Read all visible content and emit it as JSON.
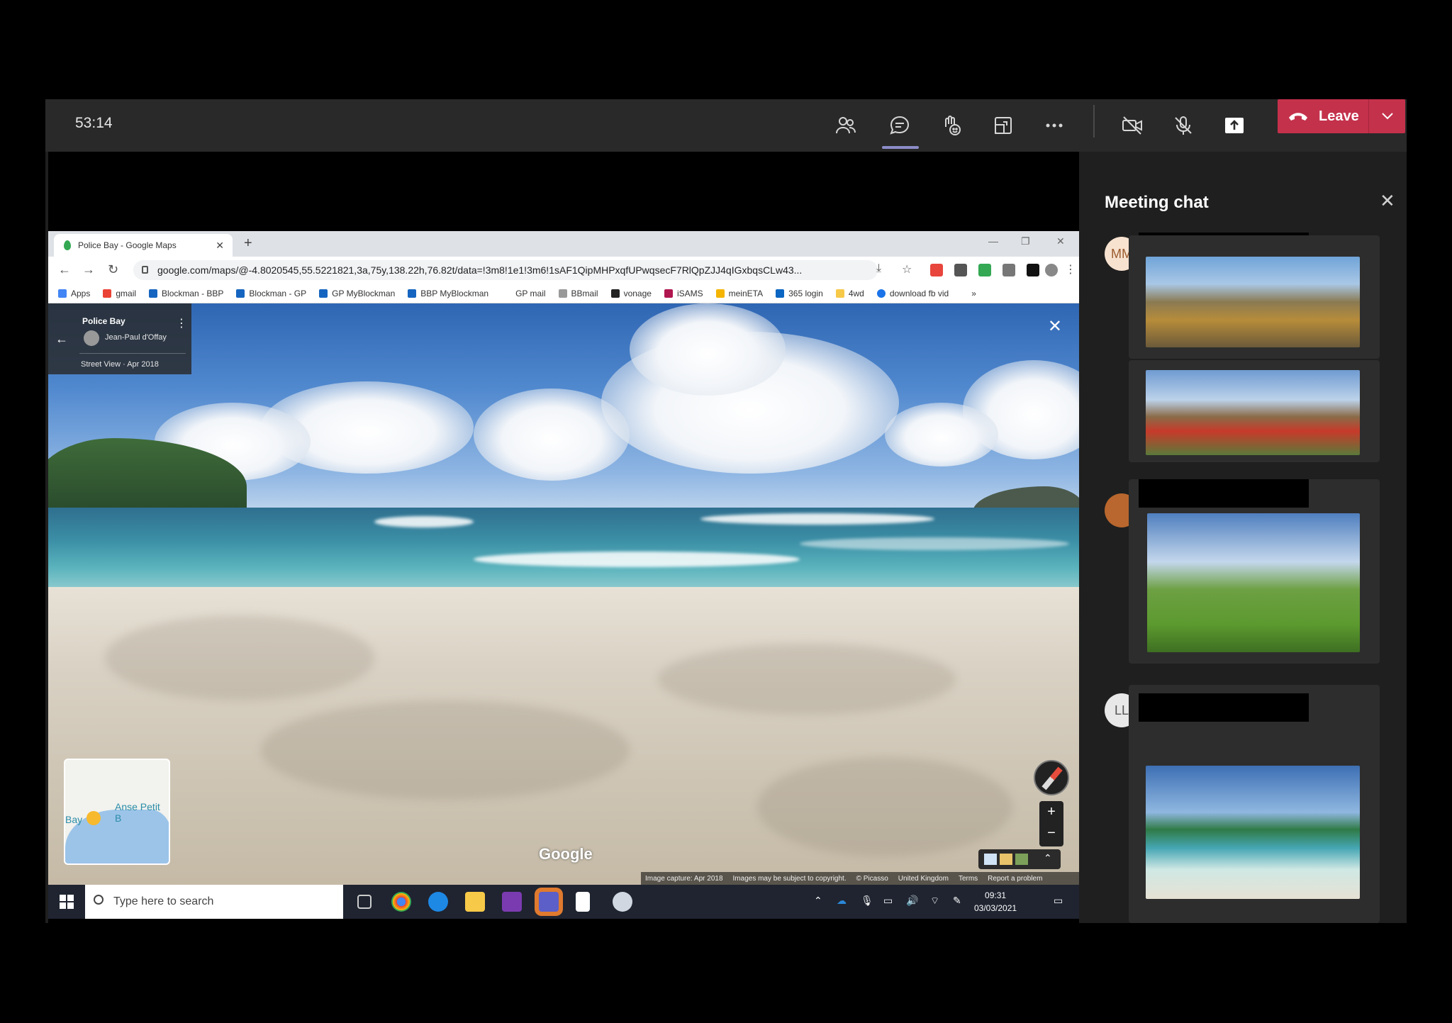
{
  "meeting": {
    "timer": "53:14",
    "leave_label": "Leave"
  },
  "browser": {
    "tab_title": "Police Bay - Google Maps",
    "url": "google.com/maps/@-4.8020545,55.5221821,3a,75y,138.22h,76.82t/data=!3m8!1e1!3m6!1sAF1QipMHPxqfUPwqsecF7RlQpZJJ4qIGxbqsCLw43...",
    "bookmarks": [
      "Apps",
      "gmail",
      "Blockman - BBP",
      "Blockman - GP",
      "GP MyBlockman",
      "BBP MyBlockman",
      "GP mail",
      "BBmail",
      "vonage",
      "iSAMS",
      "meinETA",
      "365 login",
      "4wd",
      "download fb vid",
      "»"
    ]
  },
  "streetview": {
    "place_name": "Police Bay",
    "author": "Jean-Paul d'Offay",
    "date_label": "Street View · Apr 2018",
    "minimap_label_1": "Anse Petit B",
    "minimap_label_2": "Bay",
    "logo": "Google",
    "footer": [
      "Image capture: Apr 2018",
      "Images may be subject to copyright.",
      "© Picasso",
      "United Kingdom",
      "Terms",
      "Report a problem"
    ]
  },
  "taskbar": {
    "search_placeholder": "Type here to search",
    "time": "09:31",
    "date": "03/03/2021"
  },
  "chat": {
    "title": "Meeting chat",
    "participants": [
      {
        "initials": "MM"
      },
      {
        "initials": ""
      },
      {
        "initials": "LL"
      }
    ]
  },
  "colors": {
    "teams_bg": "#1f1f1f",
    "leave_red": "#c4314b",
    "accent_underline": "#8b8cc7",
    "presence_green": "#6bb700"
  }
}
